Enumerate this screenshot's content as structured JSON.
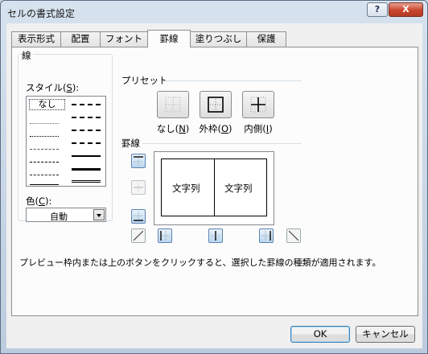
{
  "window": {
    "title": "セルの書式設定",
    "help_label": "?",
    "close_label": "X"
  },
  "tabs": [
    {
      "label": "表示形式",
      "active": false
    },
    {
      "label": "配置",
      "active": false
    },
    {
      "label": "フォント",
      "active": false
    },
    {
      "label": "罫線",
      "active": true
    },
    {
      "label": "塗りつぶし",
      "active": false
    },
    {
      "label": "保護",
      "active": false
    }
  ],
  "line_group": {
    "label": "線",
    "style_label_pre": "スタイル(",
    "style_label_key": "S",
    "style_label_post": "):",
    "selected_style": "なし",
    "color_label_pre": "色(",
    "color_label_key": "C",
    "color_label_post": "):",
    "color_value": "自動"
  },
  "presets": {
    "label": "プリセット",
    "items": [
      {
        "pre": "なし(",
        "key": "N",
        "post": ")"
      },
      {
        "pre": "外枠(",
        "key": "O",
        "post": ")"
      },
      {
        "pre": "内側(",
        "key": "I",
        "post": ")"
      }
    ]
  },
  "border": {
    "label": "罫線",
    "preview_cells": [
      "文字列",
      "文字列"
    ]
  },
  "description": "プレビュー枠内または上のボタンをクリックすると、選択した罫線の種類が適用されます。",
  "buttons": {
    "ok": "OK",
    "cancel": "キャンセル"
  }
}
